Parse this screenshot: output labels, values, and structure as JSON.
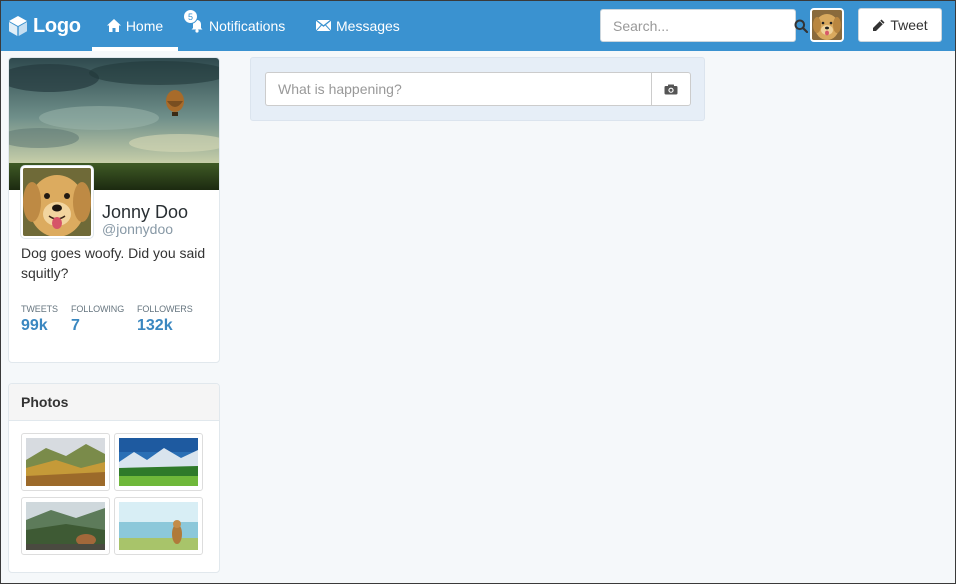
{
  "navbar": {
    "brand": "Logo",
    "home_label": "Home",
    "notifications_label": "Notifications",
    "notifications_count": "5",
    "messages_label": "Messages",
    "search_placeholder": "Search...",
    "tweet_label": "Tweet",
    "accent": "#3a92d0"
  },
  "profile": {
    "name": "Jonny Doo",
    "handle": "@jonnydoo",
    "bio": "Dog goes woofy. Did you said squitly?",
    "stats": [
      {
        "label": "TWEETS",
        "value": "99k"
      },
      {
        "label": "FOLLOWING",
        "value": "7"
      },
      {
        "label": "FOLLOWERS",
        "value": "132k"
      }
    ]
  },
  "photos": {
    "title": "Photos"
  },
  "composer": {
    "placeholder": "What is happening?"
  },
  "icons": [
    "logo-cube-icon",
    "home-icon",
    "bell-icon",
    "envelope-icon",
    "search-icon",
    "pencil-icon",
    "camera-icon"
  ]
}
